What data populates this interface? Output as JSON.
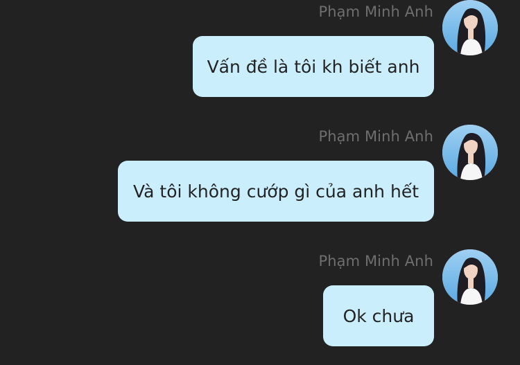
{
  "messages": [
    {
      "sender": "Phạm Minh Anh",
      "text": "Vấn đề là tôi kh biết anh"
    },
    {
      "sender": "Phạm Minh Anh",
      "text": "Và tôi không cướp gì của anh hết"
    },
    {
      "sender": "Phạm Minh Anh",
      "text": "Ok chưa"
    }
  ],
  "colors": {
    "background": "#222222",
    "bubble": "#cbeefd",
    "sender_text": "#6f6f6f",
    "message_text": "#232323"
  },
  "icons": {
    "avatar": "user-photo-avatar"
  }
}
